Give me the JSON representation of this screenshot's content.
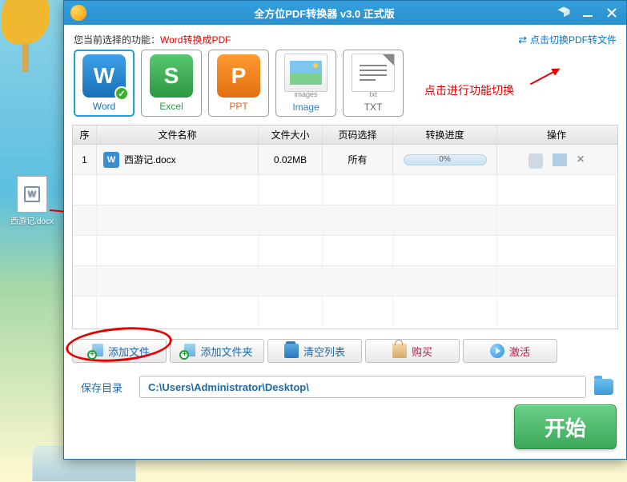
{
  "titlebar": {
    "title": "全方位PDF转换器 v3.0 正式版"
  },
  "infobar": {
    "prefix": "您当前选择的功能：",
    "func": "Word转换成PDF",
    "switch_label": "点击切换PDF转文件"
  },
  "annotations": {
    "switch_hint": "点击进行功能切换"
  },
  "formats": [
    {
      "label": "Word",
      "letter": "W",
      "cls": "word",
      "label_cls": "word-c",
      "active": true,
      "check": true
    },
    {
      "label": "Excel",
      "letter": "S",
      "cls": "excel",
      "label_cls": "excel-c"
    },
    {
      "label": "PPT",
      "letter": "P",
      "cls": "ppt",
      "label_cls": "ppt-c"
    },
    {
      "label": "Image",
      "cls": "image",
      "label_cls": "image-c",
      "sub": "images"
    },
    {
      "label": "TXT",
      "cls": "txt",
      "label_cls": "txt-c",
      "sub": "txt"
    }
  ],
  "table": {
    "headers": {
      "idx": "序",
      "name": "文件名称",
      "size": "文件大小",
      "page": "页码选择",
      "prog": "转换进度",
      "op": "操作"
    },
    "rows": [
      {
        "idx": "1",
        "name": "西游记.docx",
        "size": "0.02MB",
        "page": "所有",
        "prog": "0%"
      }
    ]
  },
  "buttons": {
    "add_file": "添加文件",
    "add_folder": "添加文件夹",
    "clear": "清空列表",
    "buy": "购买",
    "activate": "激活"
  },
  "save": {
    "label": "保存目录",
    "path": "C:\\Users\\Administrator\\Desktop\\"
  },
  "start": "开始",
  "desktop_file": "西游记.docx"
}
